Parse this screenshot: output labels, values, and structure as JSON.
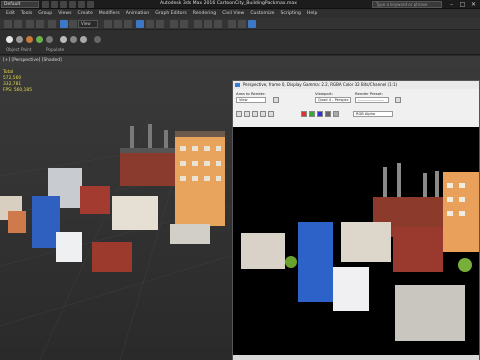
{
  "title_bar": {
    "workspace": "Default",
    "app_title": "Autodesk 3ds Max 2016      CartoonCity_BuildingPackmax.max",
    "search_placeholder": "Type a keyword or phrase"
  },
  "menu": [
    "Edit",
    "Tools",
    "Group",
    "Views",
    "Create",
    "Modifiers",
    "Animation",
    "Graph Editors",
    "Rendering",
    "Civil View",
    "Customize",
    "Scripting",
    "Help"
  ],
  "toolbar": {
    "selection_set": "View"
  },
  "ribbon": {
    "labels": [
      "Object Paint",
      "Populate"
    ]
  },
  "viewport": {
    "label": "[+] [Perspective] [Shaded]",
    "stats": [
      "Total",
      "572,560",
      "332,781",
      "",
      "FPS: 560,185"
    ]
  },
  "render_window": {
    "title": "Perspective, frame 0, Display Gamma: 2.2, RGBA Color 32 Bits/Channel (1:1)",
    "area_label": "Area to Render:",
    "area_value": "View",
    "viewport_label": "Viewport:",
    "viewport_value": "Quad 4 - Perspec",
    "preset_label": "Render Preset:",
    "preset_value": "--------------------",
    "channel_value": "RGB Alpha"
  },
  "colors": {
    "accent": "#3d78c5",
    "stats": "#e6d84a",
    "render_bg": "#000000",
    "panel_bg": "#f0f0f0"
  },
  "icons": [
    "undo-icon",
    "redo-icon",
    "link-icon",
    "select-icon",
    "move-icon",
    "rotate-icon",
    "scale-icon",
    "render-icon",
    "teapot-icon",
    "close-icon",
    "minimize-icon",
    "maximize-icon"
  ]
}
